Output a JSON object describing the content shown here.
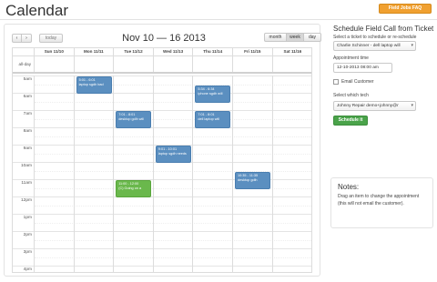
{
  "page": {
    "title": "Calendar",
    "faq_button": "Field Jobs FAQ"
  },
  "calendar": {
    "nav": {
      "prev": "‹",
      "next": "›",
      "today": "today"
    },
    "range_title": "Nov 10 — 16 2013",
    "views": [
      "month",
      "week",
      "day"
    ],
    "active_view": "week",
    "days": [
      "Sun 11/10",
      "Mon 11/11",
      "Tue 11/12",
      "Wed 11/13",
      "Thu 11/14",
      "Fri 11/15",
      "Sat 11/16"
    ],
    "allday_label": "all-day",
    "hours": [
      "5am",
      "6am",
      "7am",
      "8am",
      "9am",
      "10am",
      "11am",
      "12pm",
      "1pm",
      "2pm",
      "3pm",
      "4pm"
    ],
    "events": [
      {
        "day": 1,
        "start": 5.0,
        "time": "5:01 - 6:01",
        "desc": "laptop sgdh bad",
        "color": "blue"
      },
      {
        "day": 4,
        "start": 5.5,
        "time": "5:34 - 6:34",
        "desc": "iphone sgdh will",
        "color": "blue"
      },
      {
        "day": 2,
        "start": 7.0,
        "time": "7:01 - 8:01",
        "desc": "desktop gdih will",
        "color": "blue"
      },
      {
        "day": 4,
        "start": 7.0,
        "time": "7:01 - 8:01",
        "desc": "dell laptop will",
        "color": "blue"
      },
      {
        "day": 3,
        "start": 9.0,
        "time": "9:01 - 10:01",
        "desc": "laptop sgdh needs",
        "color": "blue"
      },
      {
        "day": 5,
        "start": 10.5,
        "time": "10:35 - 11:35",
        "desc": "desktop gdih",
        "color": "blue"
      },
      {
        "day": 2,
        "start": 11.0,
        "time": "11:00 - 12:00",
        "desc": "(C) Going on a",
        "color": "green"
      }
    ]
  },
  "sidebar": {
    "title": "Schedule Field Call from Ticket",
    "ticket_label": "Select a ticket to schedule or re-schedule",
    "ticket_value": "Charlie Schinner - dell laptop will",
    "appt_label": "Appointment time",
    "appt_value": "12-10-2013 08:00 am",
    "email_label": "Email Customer",
    "tech_label": "Select which tech",
    "tech_value": "Johnny Repair demo+johnny@r",
    "schedule_button": "Schedule it",
    "notes_title": "Notes:",
    "notes_body": "Drag an item to change the appointment (this will not email the customer)."
  }
}
